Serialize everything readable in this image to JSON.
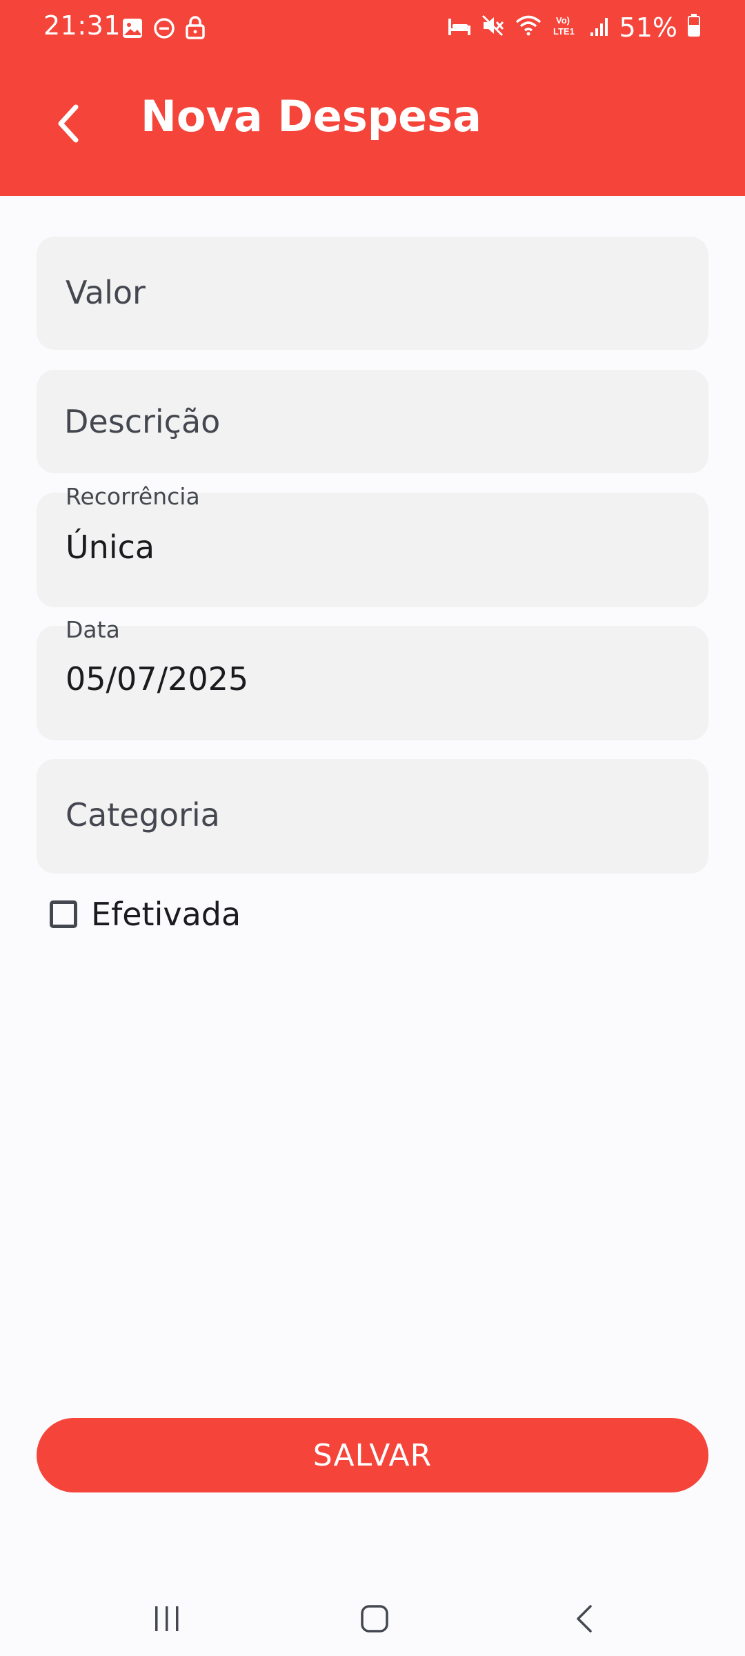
{
  "status_bar": {
    "time": "21:31",
    "battery": "51%",
    "icons_left": [
      "image-icon",
      "dnd-icon",
      "lock-icon"
    ],
    "icons_right": [
      "sleep-icon",
      "mute-icon",
      "wifi-icon",
      "volte-icon",
      "signal-icon",
      "battery-icon"
    ]
  },
  "app_bar": {
    "title": "Nova Despesa",
    "back_icon": "chevron-left-icon",
    "color": "#f5443a"
  },
  "form": {
    "valor": {
      "placeholder": "Valor"
    },
    "descricao": {
      "placeholder": "Descrição"
    },
    "recorrencia": {
      "label": "Recorrência",
      "value": "Única"
    },
    "data": {
      "label": "Data",
      "value": "05/07/2025"
    },
    "categoria": {
      "placeholder": "Categoria"
    },
    "efetivada": {
      "label": "Efetivada",
      "checked": false
    }
  },
  "actions": {
    "save_label": "SALVAR"
  },
  "nav_bar": {
    "icons": [
      "recent-apps-icon",
      "home-icon",
      "back-icon"
    ]
  }
}
